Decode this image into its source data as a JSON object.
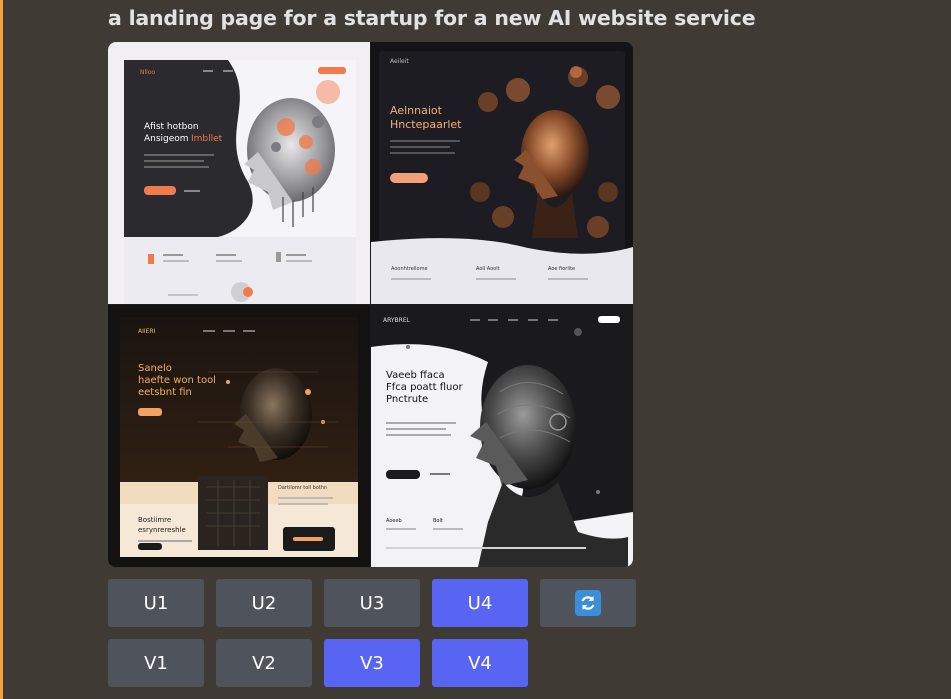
{
  "prompt": "a landing page for a startup for a new AI website service",
  "tiles": {
    "t1": {
      "logo": "Nlloo",
      "heading_1": "Afist hotbon",
      "heading_2": "Ansigeom",
      "heading_2b": "Imbllet"
    },
    "t2": {
      "logo": "Aeileit",
      "heading_1": "Aelnnaiot",
      "heading_2": "Hnctepaarlet",
      "footer_1": "Aoonhtrellome",
      "footer_2": "Aoll Aoolt",
      "footer_3": "Aoe fiorlite"
    },
    "t3": {
      "logo": "AIIERI",
      "heading_1": "Sanelo",
      "heading_2": "haefte won tool",
      "heading_3": "eetsbnt fin",
      "sub_1": "Bostiimre",
      "sub_2": "esrynrereshle",
      "sub_3": "Dartilomr toll bothn"
    },
    "t4": {
      "logo": "ARYBREL",
      "heading_1": "Vaeeb ffaca",
      "heading_2": "Ffca poatt fluor",
      "heading_3": "Pnctrute",
      "footer_1": "Aoeeb",
      "footer_2": "Bolt"
    }
  },
  "buttons": {
    "row1": [
      {
        "label": "U1",
        "active": false
      },
      {
        "label": "U2",
        "active": false
      },
      {
        "label": "U3",
        "active": false
      },
      {
        "label": "U4",
        "active": true
      }
    ],
    "row2": [
      {
        "label": "V1",
        "active": false
      },
      {
        "label": "V2",
        "active": false
      },
      {
        "label": "V3",
        "active": true
      },
      {
        "label": "V4",
        "active": true
      }
    ],
    "reroll_icon": "reroll-icon"
  },
  "colors": {
    "background": "#403a35",
    "accent_bar": "#f0a33a",
    "button": "#4f545c",
    "button_active": "#5865f2",
    "text": "#e2e2e2"
  }
}
